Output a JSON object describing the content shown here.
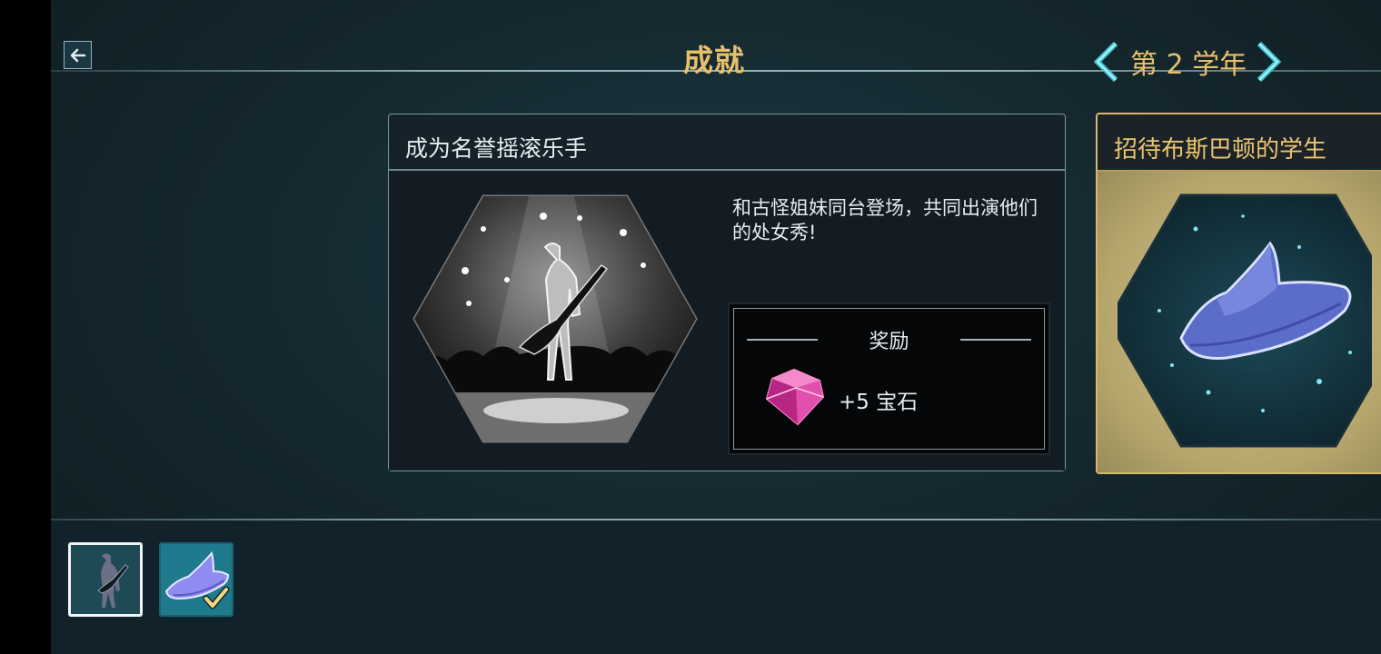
{
  "header": {
    "title": "成就",
    "back_icon": "arrow-left-icon",
    "year_label": "第 2 学年",
    "prev_icon": "chevron-left-icon",
    "next_icon": "chevron-right-icon"
  },
  "achievement_card": {
    "title": "成为名誉摇滚乐手",
    "image": "rock-star-on-stage",
    "description": "和古怪姐妹同台登场，共同出演他们的处女秀!",
    "reward": {
      "title": "奖励",
      "icon": "pink-gem-icon",
      "amount": "+5 宝石"
    }
  },
  "next_card": {
    "title": "招待布斯巴顿的学生",
    "image": "blue-witch-hat"
  },
  "thumbnails": [
    {
      "icon": "guitarist-icon",
      "selected": true
    },
    {
      "icon": "witch-hat-icon",
      "completed": true
    }
  ],
  "colors": {
    "gold": "#e8c06a",
    "teal": "#1e7a8c"
  }
}
